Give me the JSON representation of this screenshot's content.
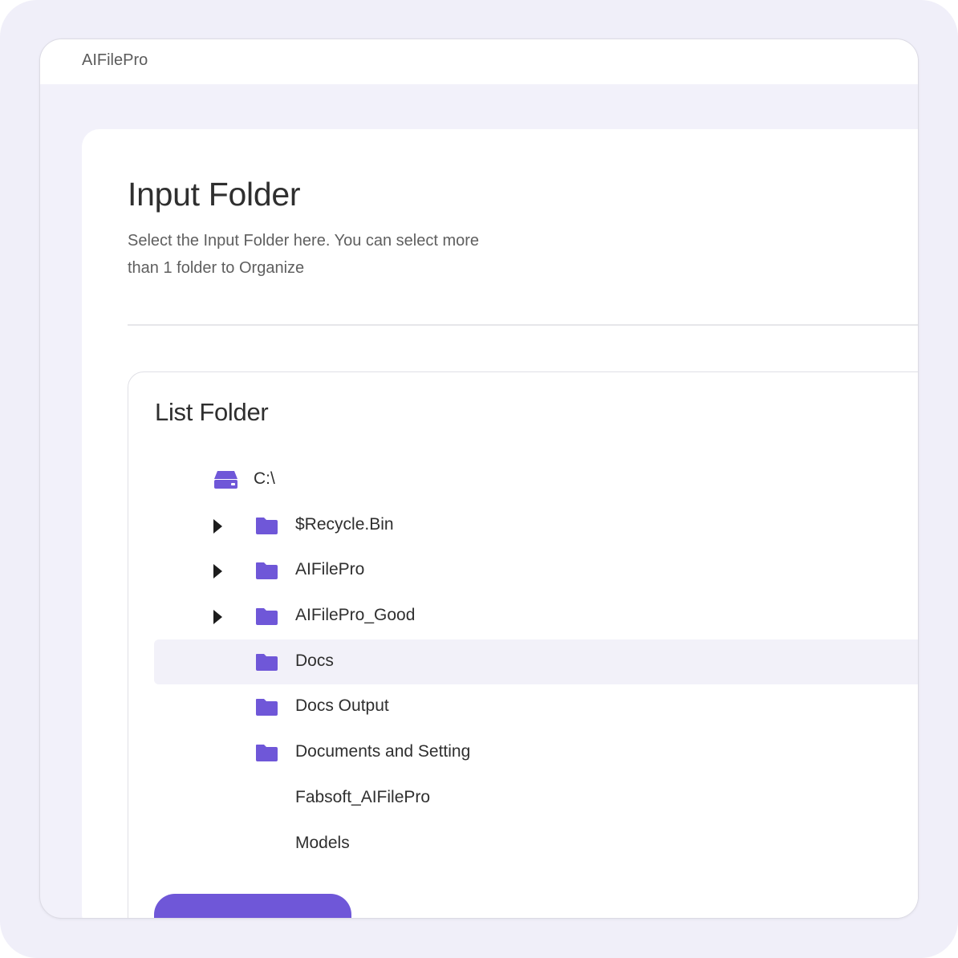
{
  "window": {
    "app_title": "AIFilePro"
  },
  "header": {
    "title": "Input Folder",
    "description": "Select the Input Folder here. You can select more than 1 folder to Organize"
  },
  "list_folder": {
    "title": "List Folder",
    "drive": {
      "label": "C:\\",
      "icon": "drive-icon"
    },
    "items": [
      {
        "label": "$Recycle.Bin",
        "expandable": true,
        "icon": "folder-icon",
        "selected": false
      },
      {
        "label": "AIFilePro",
        "expandable": true,
        "icon": "folder-icon",
        "selected": false
      },
      {
        "label": "AIFilePro_Good",
        "expandable": true,
        "icon": "folder-icon",
        "selected": false
      },
      {
        "label": "Docs",
        "expandable": false,
        "icon": "folder-icon",
        "selected": true
      },
      {
        "label": "Docs Output",
        "expandable": false,
        "icon": "folder-icon",
        "selected": false
      },
      {
        "label": "Documents and Setting",
        "expandable": false,
        "icon": "folder-icon",
        "selected": false
      },
      {
        "label": "Fabsoft_AIFilePro",
        "expandable": false,
        "icon": "",
        "selected": false
      },
      {
        "label": "Models",
        "expandable": false,
        "icon": "",
        "selected": false
      }
    ]
  },
  "colors": {
    "accent": "#6f57d8",
    "selected_row": "#f2f1f9",
    "text_primary": "#2f2f2f",
    "text_secondary": "#5f5f5f"
  }
}
